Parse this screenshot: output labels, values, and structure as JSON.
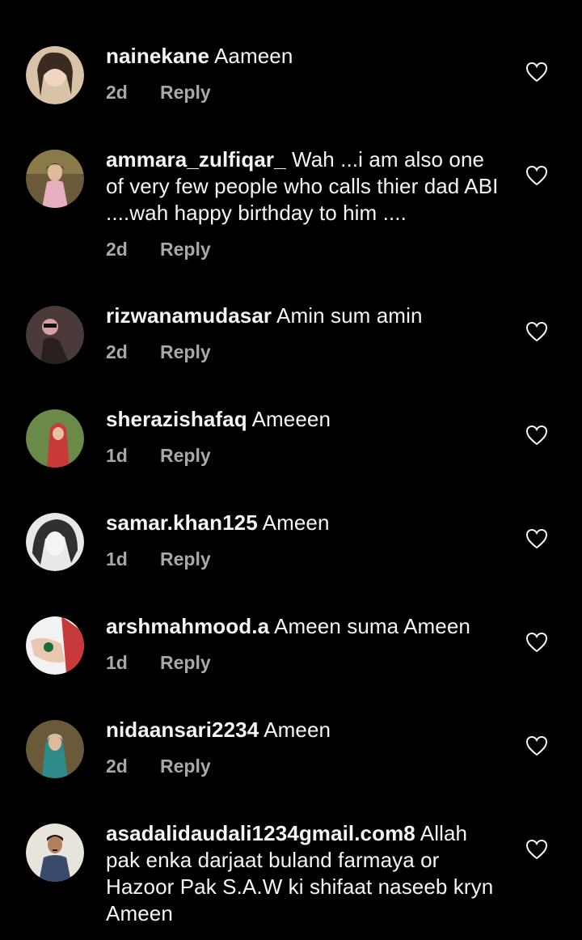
{
  "comments": [
    {
      "username": "nainekane",
      "text": "Aameen",
      "time": "2d",
      "reply": "Reply",
      "avatar_bg": "#d9c3a8",
      "avatar_fg": "#3a2a20"
    },
    {
      "username": "ammara_zulfiqar_",
      "text": "Wah ...i am also one of very few people who calls thier dad ABI ....wah happy birthday to him ....",
      "time": "2d",
      "reply": "Reply",
      "avatar_bg": "#6b5a3a",
      "avatar_fg": "#e7b0c0"
    },
    {
      "username": "rizwanamudasar",
      "text": "Amin sum amin",
      "time": "2d",
      "reply": "Reply",
      "avatar_bg": "#4a3a3a",
      "avatar_fg": "#d8a0a0"
    },
    {
      "username": "sherazishafaq",
      "text": "Ameeen",
      "time": "1d",
      "reply": "Reply",
      "avatar_bg": "#6b8a4a",
      "avatar_fg": "#c83a3a"
    },
    {
      "username": "samar.khan125",
      "text": "Ameen",
      "time": "1d",
      "reply": "Reply",
      "avatar_bg": "#e8e8e8",
      "avatar_fg": "#303030"
    },
    {
      "username": "arshmahmood.a",
      "text": "Ameen suma Ameen",
      "time": "1d",
      "reply": "Reply",
      "avatar_bg": "#f2f2f2",
      "avatar_fg": "#c83a3a"
    },
    {
      "username": "nidaansari2234",
      "text": "Ameen",
      "time": "2d",
      "reply": "Reply",
      "avatar_bg": "#6a5a3a",
      "avatar_fg": "#2f8a8a"
    },
    {
      "username": "asadalidaudali1234gmail.com8",
      "text": "Allah pak enka darjaat buland farmaya or Hazoor Pak S.A.W ki shifaat naseeb kryn Ameen",
      "time": "",
      "reply": "",
      "avatar_bg": "#e8e4dc",
      "avatar_fg": "#3a4a6a"
    }
  ],
  "icons": {
    "like": "heart-outline-icon"
  },
  "colors": {
    "background": "#000000",
    "text": "#f5f5f5",
    "meta": "#a8a8a8"
  }
}
